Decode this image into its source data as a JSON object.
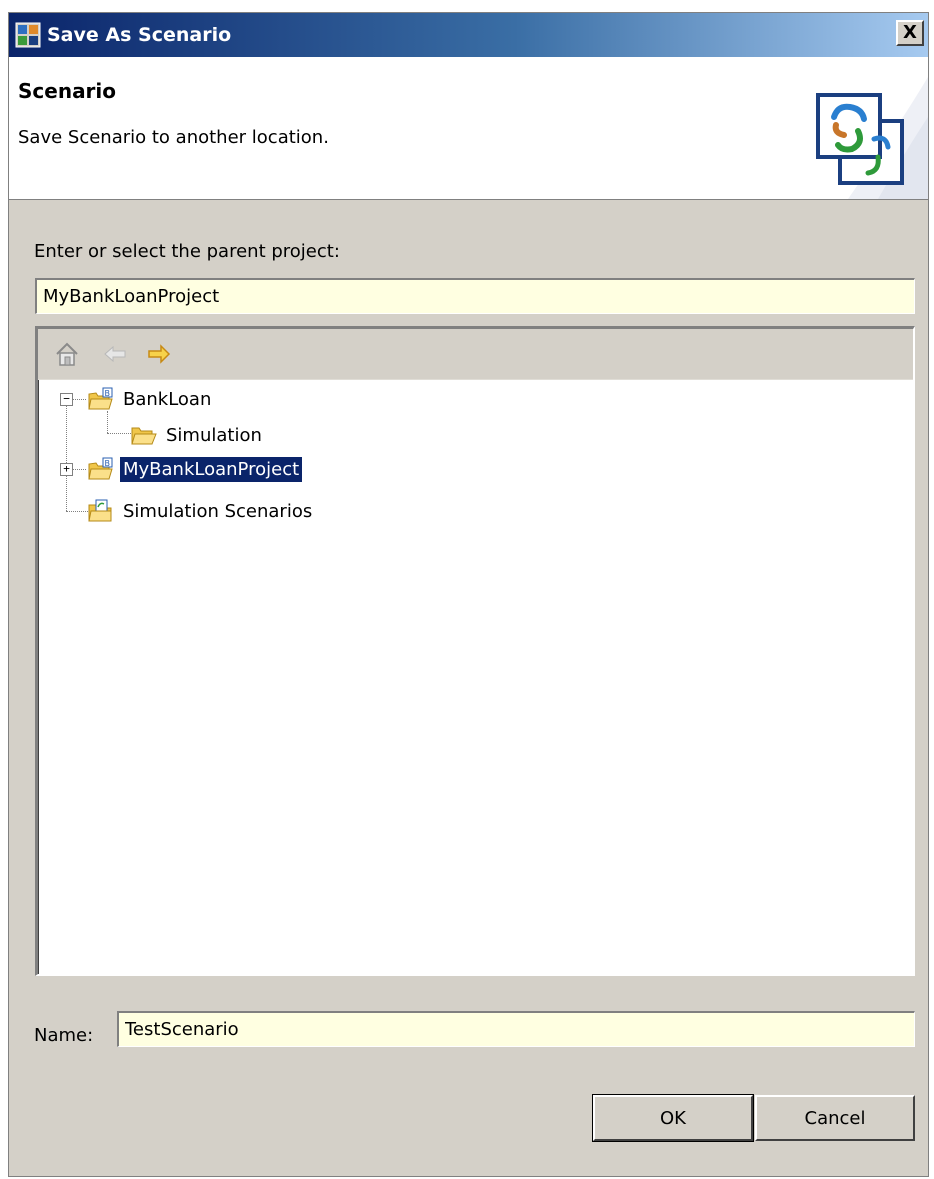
{
  "window": {
    "title": "Save As Scenario",
    "close_label": "X",
    "title_icon": "scenario-app-icon"
  },
  "banner": {
    "title": "Scenario",
    "description": "Save Scenario to another location.",
    "icon": "scenario-wizard-icon"
  },
  "parent": {
    "label": "Enter or select the parent project:",
    "value": "MyBankLoanProject"
  },
  "toolbar": {
    "home_icon": "home-icon",
    "back_icon": "back-arrow-icon",
    "forward_icon": "forward-arrow-icon"
  },
  "tree": {
    "items": [
      {
        "label": "BankLoan",
        "icon": "project-folder-icon",
        "expanded": true,
        "level": 0
      },
      {
        "label": "Simulation",
        "icon": "folder-open-icon",
        "level": 1
      },
      {
        "label": "MyBankLoanProject",
        "icon": "project-folder-icon",
        "expanded": false,
        "selected": true,
        "level": 0
      },
      {
        "label": "Simulation Scenarios",
        "icon": "scenarios-folder-icon",
        "level": 0
      }
    ]
  },
  "name": {
    "label": "Name:",
    "value": "TestScenario"
  },
  "buttons": {
    "ok": "OK",
    "cancel": "Cancel"
  },
  "colors": {
    "selection": "#0a246a",
    "input_bg": "#ffffe1",
    "dialog_bg": "#d4d0c8"
  }
}
